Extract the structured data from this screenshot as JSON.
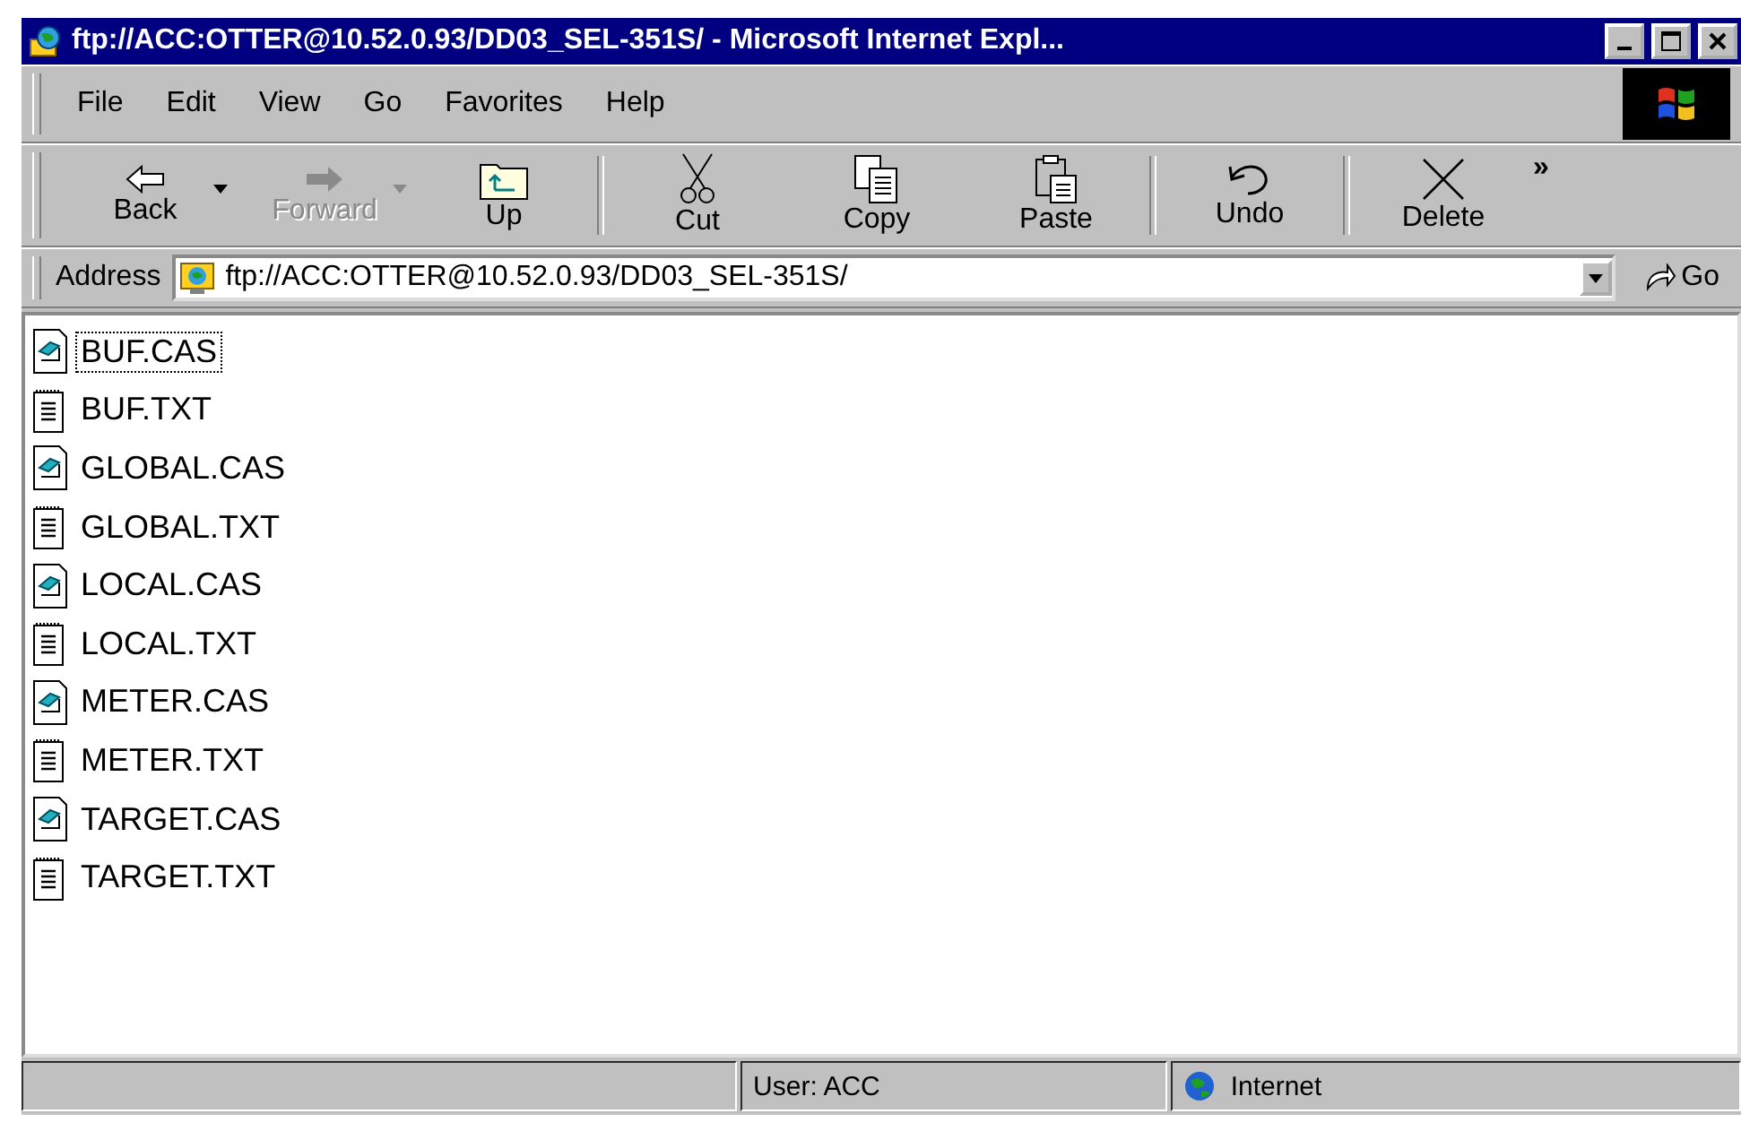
{
  "window": {
    "title": "ftp://ACC:OTTER@10.52.0.93/DD03_SEL-351S/ - Microsoft Internet Expl..."
  },
  "menu": [
    "File",
    "Edit",
    "View",
    "Go",
    "Favorites",
    "Help"
  ],
  "toolbar": [
    [
      {
        "label": "Back",
        "disabled": false,
        "dropdown": true
      },
      {
        "label": "Forward",
        "disabled": true,
        "dropdown": true
      },
      {
        "label": "Up",
        "disabled": false,
        "dropdown": false
      }
    ],
    [
      {
        "label": "Cut",
        "disabled": false,
        "dropdown": false
      },
      {
        "label": "Copy",
        "disabled": false,
        "dropdown": false
      },
      {
        "label": "Paste",
        "disabled": false,
        "dropdown": false
      }
    ],
    [
      {
        "label": "Undo",
        "disabled": false,
        "dropdown": false
      }
    ],
    [
      {
        "label": "Delete",
        "disabled": false,
        "dropdown": false
      }
    ]
  ],
  "toolbar_more": "»",
  "address": {
    "label": "Address",
    "value": "ftp://ACC:OTTER@10.52.0.93/DD03_SEL-351S/",
    "go": "Go"
  },
  "files": [
    {
      "name": "BUF.CAS",
      "kind": "cas",
      "focused": true
    },
    {
      "name": "BUF.TXT",
      "kind": "txt",
      "focused": false
    },
    {
      "name": "GLOBAL.CAS",
      "kind": "cas",
      "focused": false
    },
    {
      "name": "GLOBAL.TXT",
      "kind": "txt",
      "focused": false
    },
    {
      "name": "LOCAL.CAS",
      "kind": "cas",
      "focused": false
    },
    {
      "name": "LOCAL.TXT",
      "kind": "txt",
      "focused": false
    },
    {
      "name": "METER.CAS",
      "kind": "cas",
      "focused": false
    },
    {
      "name": "METER.TXT",
      "kind": "txt",
      "focused": false
    },
    {
      "name": "TARGET.CAS",
      "kind": "cas",
      "focused": false
    },
    {
      "name": "TARGET.TXT",
      "kind": "txt",
      "focused": false
    }
  ],
  "status_bar": {
    "user": "User: ACC",
    "zone": "Internet"
  }
}
